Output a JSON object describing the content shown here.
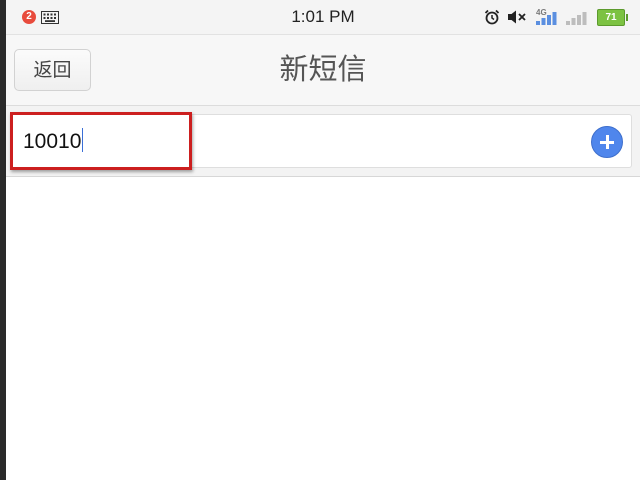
{
  "status_bar": {
    "notification_count": "2",
    "time": "1:01 PM",
    "network_type": "4G",
    "battery_level": "71",
    "icons": [
      "keyboard-icon",
      "alarm-icon",
      "mute-icon",
      "signal-icon",
      "signal-icon",
      "battery-icon"
    ]
  },
  "header": {
    "back_label": "返回",
    "title": "新短信"
  },
  "recipient": {
    "value": "10010"
  },
  "colors": {
    "accent": "#4f86ec",
    "highlight": "#cc1f1f",
    "battery": "#7cc242",
    "badge": "#e84b3c"
  }
}
